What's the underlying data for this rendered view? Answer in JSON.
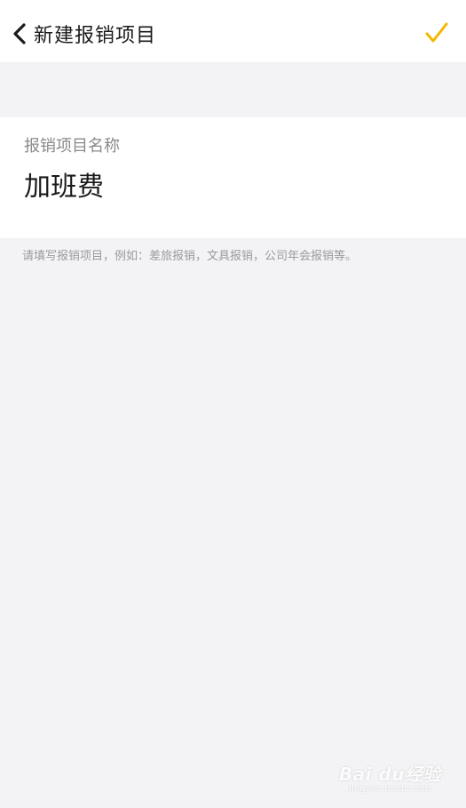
{
  "nav": {
    "title": "新建报销项目",
    "back_icon": "chevron-left-icon",
    "confirm_icon": "checkmark-icon",
    "accent_color": "#f5b800"
  },
  "form": {
    "label": "报销项目名称",
    "value": "加班费"
  },
  "hint": "请填写报销项目，例如：差旅报销，文具报销，公司年会报销等。",
  "watermark": {
    "main": "Bai du经验",
    "sub": "jingyan.baidu.com"
  }
}
